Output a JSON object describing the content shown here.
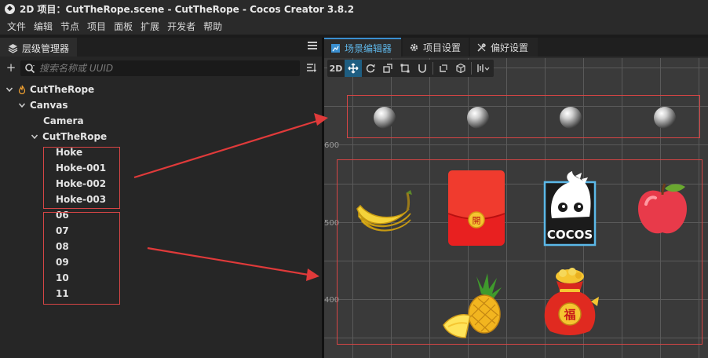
{
  "window": {
    "title": "2D 项目：CutTheRope.scene - CutTheRope - Cocos Creator 3.8.2"
  },
  "menu": [
    "文件",
    "编辑",
    "节点",
    "项目",
    "面板",
    "扩展",
    "开发者",
    "帮助"
  ],
  "hierarchy": {
    "tab_label": "层级管理器",
    "search_placeholder": "搜索名称或 UUID",
    "nodes": [
      {
        "label": "CutTheRope"
      },
      {
        "label": "Canvas"
      },
      {
        "label": "Camera"
      },
      {
        "label": "CutTheRope"
      },
      {
        "label": "Hoke"
      },
      {
        "label": "Hoke-001"
      },
      {
        "label": "Hoke-002"
      },
      {
        "label": "Hoke-003"
      },
      {
        "label": "06"
      },
      {
        "label": "07"
      },
      {
        "label": "08"
      },
      {
        "label": "09"
      },
      {
        "label": "10"
      },
      {
        "label": "11"
      }
    ]
  },
  "editor_tabs": [
    {
      "label": "场景编辑器"
    },
    {
      "label": "项目设置"
    },
    {
      "label": "偏好设置"
    }
  ],
  "scene": {
    "mode_label": "2D",
    "axis_labels": [
      "600",
      "500",
      "400"
    ],
    "sprites": [
      {
        "name": "metal-ball"
      },
      {
        "name": "metal-ball"
      },
      {
        "name": "metal-ball"
      },
      {
        "name": "metal-ball"
      },
      {
        "name": "banana"
      },
      {
        "name": "red-envelope"
      },
      {
        "name": "cocos-logo"
      },
      {
        "name": "apple"
      },
      {
        "name": "pineapple"
      },
      {
        "name": "lucky-bag"
      }
    ],
    "cocos_text": "COCOS",
    "envelope_text": "開",
    "lucky_bag_text": "福"
  },
  "colors": {
    "accent": "#3a8fd0",
    "annotation": "#e03a3a"
  }
}
